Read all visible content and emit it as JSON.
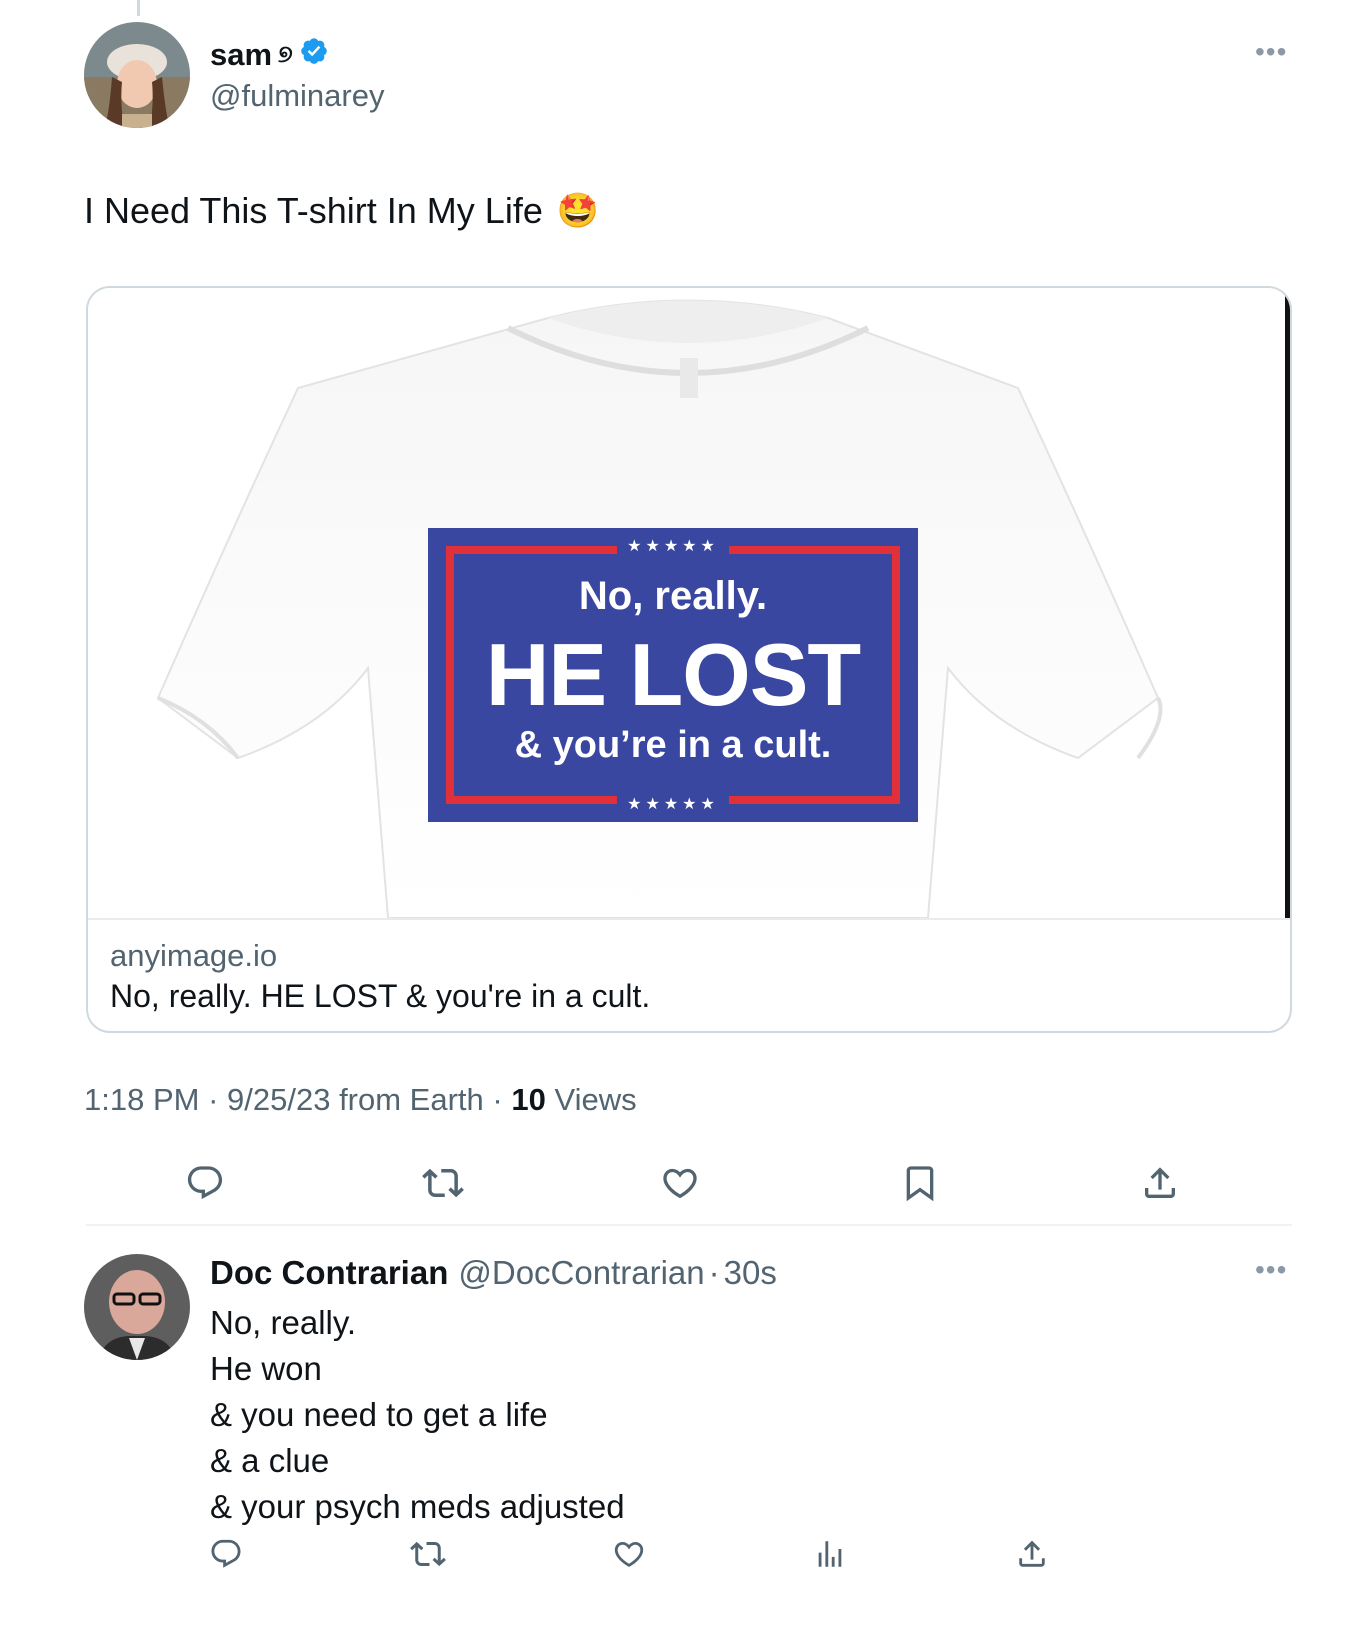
{
  "main_tweet": {
    "author_name": "sam",
    "name_suffix": "୭",
    "verified": true,
    "handle": "@fulminarey",
    "text": "I Need This T-shirt In My Life",
    "emoji": "🤩",
    "more": "•••"
  },
  "card": {
    "domain": "anyimage.io",
    "title": "No, really. HE LOST & you're in a cult.",
    "shirt_print": {
      "stars": "★★★★★",
      "line1": "No, really.",
      "line2": "HE LOST",
      "line3": "& you’re in a cult."
    }
  },
  "meta": {
    "time": "1:18 PM",
    "sep1": "·",
    "date_source": "9/25/23 from Earth",
    "sep2": "·",
    "views_count": "10",
    "views_label": "Views"
  },
  "main_actions": [
    {
      "icon": "reply-icon"
    },
    {
      "icon": "retweet-icon"
    },
    {
      "icon": "like-icon"
    },
    {
      "icon": "bookmark-icon"
    },
    {
      "icon": "share-icon"
    }
  ],
  "reply": {
    "author_name": "Doc Contrarian",
    "handle": "@DocContrarian",
    "dot": "·",
    "time": "30s",
    "more": "•••",
    "lines": [
      "No, really.",
      "He won",
      "& you need to get a life",
      "& a clue",
      "& your psych meds adjusted"
    ]
  },
  "reply_actions": [
    {
      "icon": "reply-icon"
    },
    {
      "icon": "retweet-icon"
    },
    {
      "icon": "like-icon"
    },
    {
      "icon": "analytics-icon"
    },
    {
      "icon": "share-icon"
    }
  ],
  "colors": {
    "text": "#0f1419",
    "secondary": "#536471",
    "verified": "#1d9bf0",
    "border": "#cfd9de",
    "sign_blue": "#3a47a0",
    "sign_red": "#e0303a"
  }
}
